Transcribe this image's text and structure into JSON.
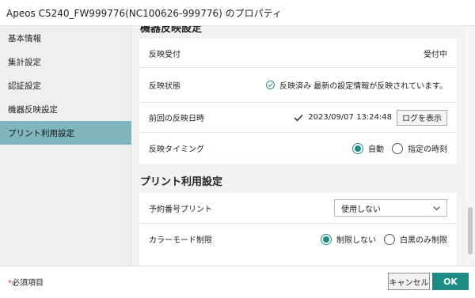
{
  "window": {
    "title": "Apeos C5240_FW999776(NC100626-999776) のプロパティ"
  },
  "sidebar": {
    "items": [
      {
        "label": "基本情報",
        "active": false
      },
      {
        "label": "集計設定",
        "active": false
      },
      {
        "label": "認証設定",
        "active": false
      },
      {
        "label": "機器反映設定",
        "active": false
      },
      {
        "label": "プリント利用設定",
        "active": true
      }
    ]
  },
  "reflect_section": {
    "heading": "機器反映設定",
    "rows": {
      "reception": {
        "label": "反映受付",
        "value": "受付中"
      },
      "status": {
        "label": "反映状態",
        "value": "反映済み 最新の設定情報が反映されています。",
        "icon": "check-circle-icon"
      },
      "last_date": {
        "label": "前回の反映日時",
        "value": "2023/09/07 13:24:48",
        "button": "ログを表示",
        "icon": "check-icon"
      },
      "timing": {
        "label": "反映タイミング",
        "options": [
          "自動",
          "指定の時刻"
        ],
        "selected": "自動"
      }
    }
  },
  "print_section": {
    "heading": "プリント利用設定",
    "rows": {
      "reserved": {
        "label": "予約番号プリント",
        "selected": "使用しない"
      },
      "color_limit": {
        "label": "カラーモード制限",
        "options": [
          "制限しない",
          "白黒のみ制限"
        ],
        "selected": "制限しない"
      }
    }
  },
  "footer": {
    "required_star": "*",
    "required_label": "必須項目",
    "cancel": "キャンセル",
    "ok": "OK"
  },
  "colors": {
    "accent": "#1e8b85",
    "sidebar_active": "#7fb6bd",
    "content_bg": "#f2f2f2"
  }
}
